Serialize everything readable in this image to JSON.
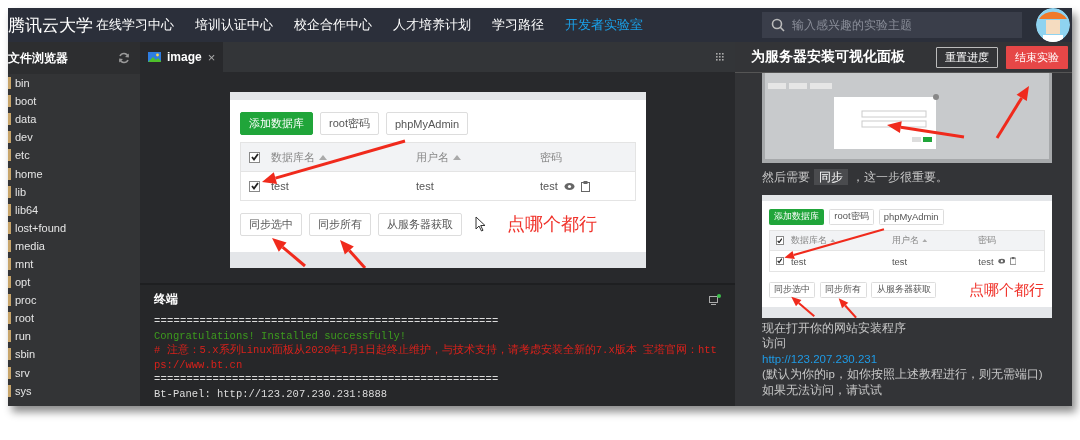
{
  "nav": {
    "logo": "腾讯云大学",
    "items": [
      {
        "label": "在线学习中心",
        "selected": false
      },
      {
        "label": "培训认证中心",
        "selected": false
      },
      {
        "label": "校企合作中心",
        "selected": false
      },
      {
        "label": "人才培养计划",
        "selected": false
      },
      {
        "label": "学习路径",
        "selected": false
      },
      {
        "label": "开发者实验室",
        "selected": true
      }
    ],
    "search": {
      "placeholder": "输入感兴趣的实验主题"
    }
  },
  "file_browser": {
    "title": "文件浏览器",
    "items": [
      "bin",
      "boot",
      "data",
      "dev",
      "etc",
      "home",
      "lib",
      "lib64",
      "lost+found",
      "media",
      "mnt",
      "opt",
      "proc",
      "root",
      "run",
      "sbin",
      "srv",
      "sys"
    ]
  },
  "editor": {
    "tabs": [
      {
        "label": "image",
        "selected": true,
        "close": "×"
      }
    ],
    "image": {
      "buttons": [
        "添加数据库",
        "root密码",
        "phpMyAdmin"
      ],
      "columns": [
        "数据库名",
        "用户名",
        "密码"
      ],
      "header_checked": true,
      "rows": [
        {
          "checked": true,
          "name": "test",
          "user": "test",
          "password": "test"
        }
      ],
      "actions": [
        "同步选中",
        "同步所有",
        "从服务器获取"
      ],
      "annotation": "点哪个都行"
    }
  },
  "terminal": {
    "title": "终端",
    "lines": [
      {
        "kind": "rule",
        "text": "====================================================="
      },
      {
        "kind": "success",
        "text": "Congratulations! Installed successfully!"
      },
      {
        "kind": "warning",
        "text": "# 注意：5.x系列Linux面板从2020年1月1日起终止维护，与技术支持，请考虑安装全新的7.x版本 宝塔官网：https://www.bt.cn"
      },
      {
        "kind": "rule",
        "text": "====================================================="
      },
      {
        "kind": "plain",
        "text": "Bt-Panel: http://123.207.230.231:8888"
      }
    ]
  },
  "guide": {
    "title": "为服务器安装可视化面板",
    "buttons": [
      {
        "label": "重置进度",
        "kind": "outline"
      },
      {
        "label": "结束实验",
        "kind": "danger"
      }
    ],
    "sync_note": {
      "before": "然后需要",
      "code": "同步",
      "after": "，这一步很重要。"
    },
    "image": {
      "buttons": [
        "添加数据库",
        "root密码",
        "phpMyAdmin"
      ],
      "columns": [
        "数据库名",
        "用户名",
        "密码"
      ],
      "header_checked": true,
      "rows": [
        {
          "checked": true,
          "name": "test",
          "user": "test",
          "password": "test"
        }
      ],
      "actions": [
        "同步选中",
        "同步所有",
        "从服务器获取"
      ],
      "annotation": "点哪个都行"
    },
    "lines": [
      {
        "kind": "text",
        "text": "现在打开你的网站安装程序"
      },
      {
        "kind": "text",
        "text": "访问"
      },
      {
        "kind": "link",
        "text": "http://123.207.230.231"
      },
      {
        "kind": "text",
        "text": "(默认为你的ip，如你按照上述教程进行，则无需端口) 如果无法访问，请试试"
      }
    ]
  }
}
